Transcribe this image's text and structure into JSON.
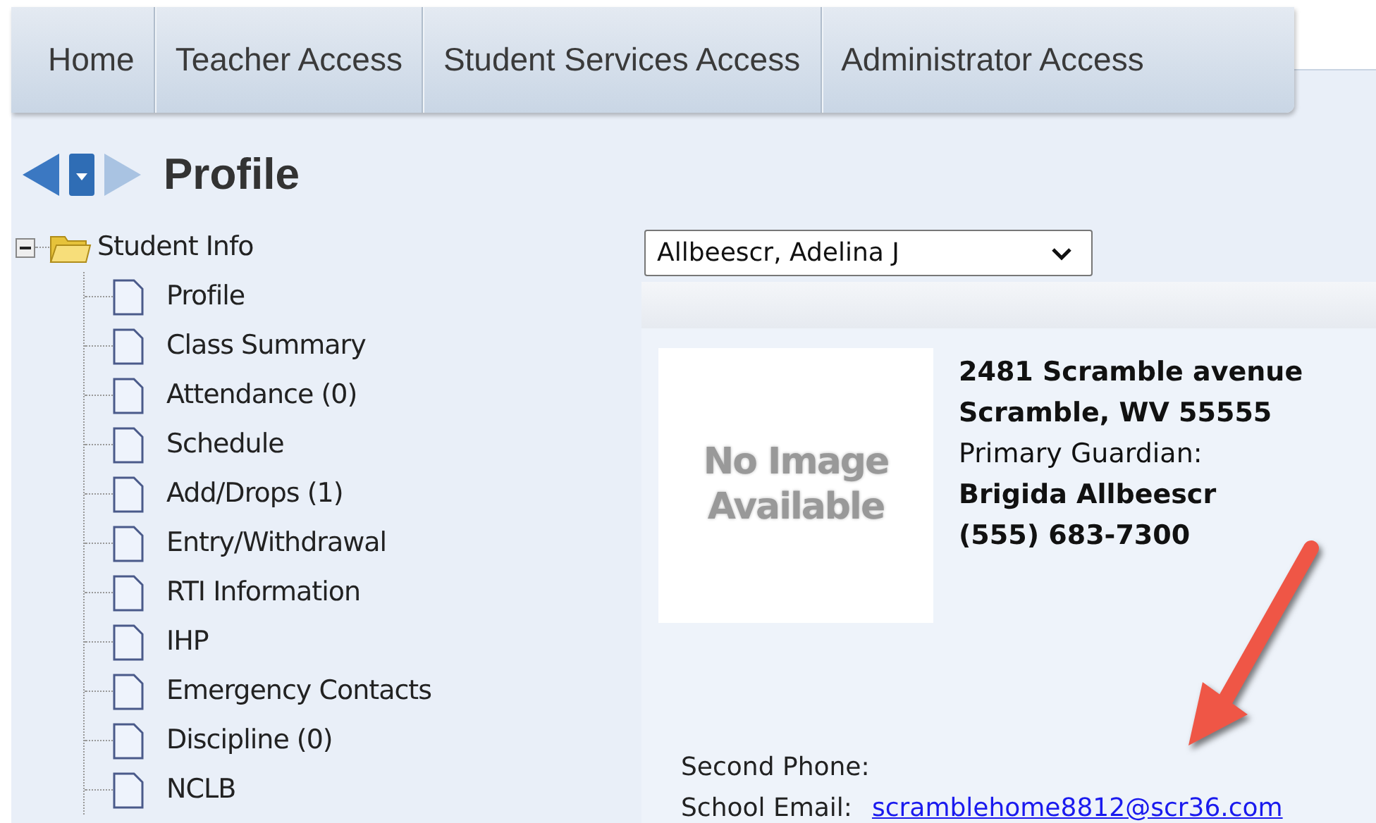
{
  "nav_tabs": [
    {
      "label": "Home"
    },
    {
      "label": "Teacher Access"
    },
    {
      "label": "Student Services Access"
    },
    {
      "label": "Administrator Access"
    }
  ],
  "page_title": "Profile",
  "tree": {
    "label": "Student Info",
    "expanded": true,
    "children": [
      {
        "label": "Profile"
      },
      {
        "label": "Class Summary"
      },
      {
        "label": "Attendance (0)"
      },
      {
        "label": "Schedule"
      },
      {
        "label": "Add/Drops (1)"
      },
      {
        "label": "Entry/Withdrawal"
      },
      {
        "label": "RTI Information"
      },
      {
        "label": "IHP"
      },
      {
        "label": "Emergency Contacts"
      },
      {
        "label": "Discipline (0)"
      },
      {
        "label": "NCLB"
      }
    ]
  },
  "student_select": {
    "value": "Allbeescr, Adelina J"
  },
  "photo": {
    "text": [
      "No Image",
      "Available"
    ]
  },
  "address": [
    {
      "text": "2481 Scramble avenue",
      "bold": true
    },
    {
      "text": "Scramble, WV 55555",
      "bold": true
    },
    {
      "text": "Primary Guardian:",
      "bold": false
    },
    {
      "text": "Brigida Allbeescr",
      "bold": true
    },
    {
      "text": "(555) 683-7300",
      "bold": true
    }
  ],
  "fields": [
    {
      "label": "Second Phone:"
    },
    {
      "label": "School Email:",
      "link": "scramblehome8812@scr36.com"
    }
  ]
}
